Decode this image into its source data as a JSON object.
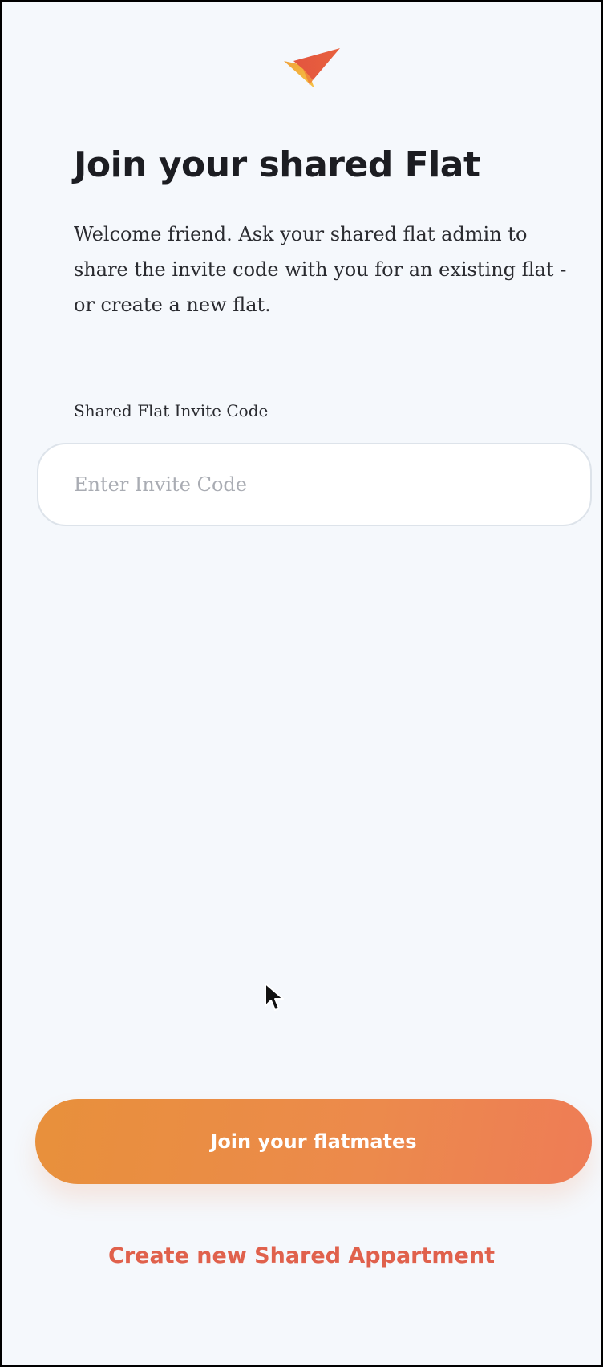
{
  "header": {
    "logo_icon": "checkmark-logo-icon",
    "title": "Join your shared Flat",
    "intro": "Welcome friend. Ask your shared flat admin to share the invite code with you for an existing flat - or create a new flat."
  },
  "form": {
    "invite_label": "Shared Flat Invite Code",
    "invite_placeholder": "Enter Invite Code",
    "invite_value": ""
  },
  "actions": {
    "join_label": "Join your flatmates",
    "create_label": "Create new Shared Appartment"
  },
  "colors": {
    "accent_start": "#e8903b",
    "accent_end": "#ee7c56",
    "link": "#e0614c",
    "background": "#f5f8fc"
  }
}
